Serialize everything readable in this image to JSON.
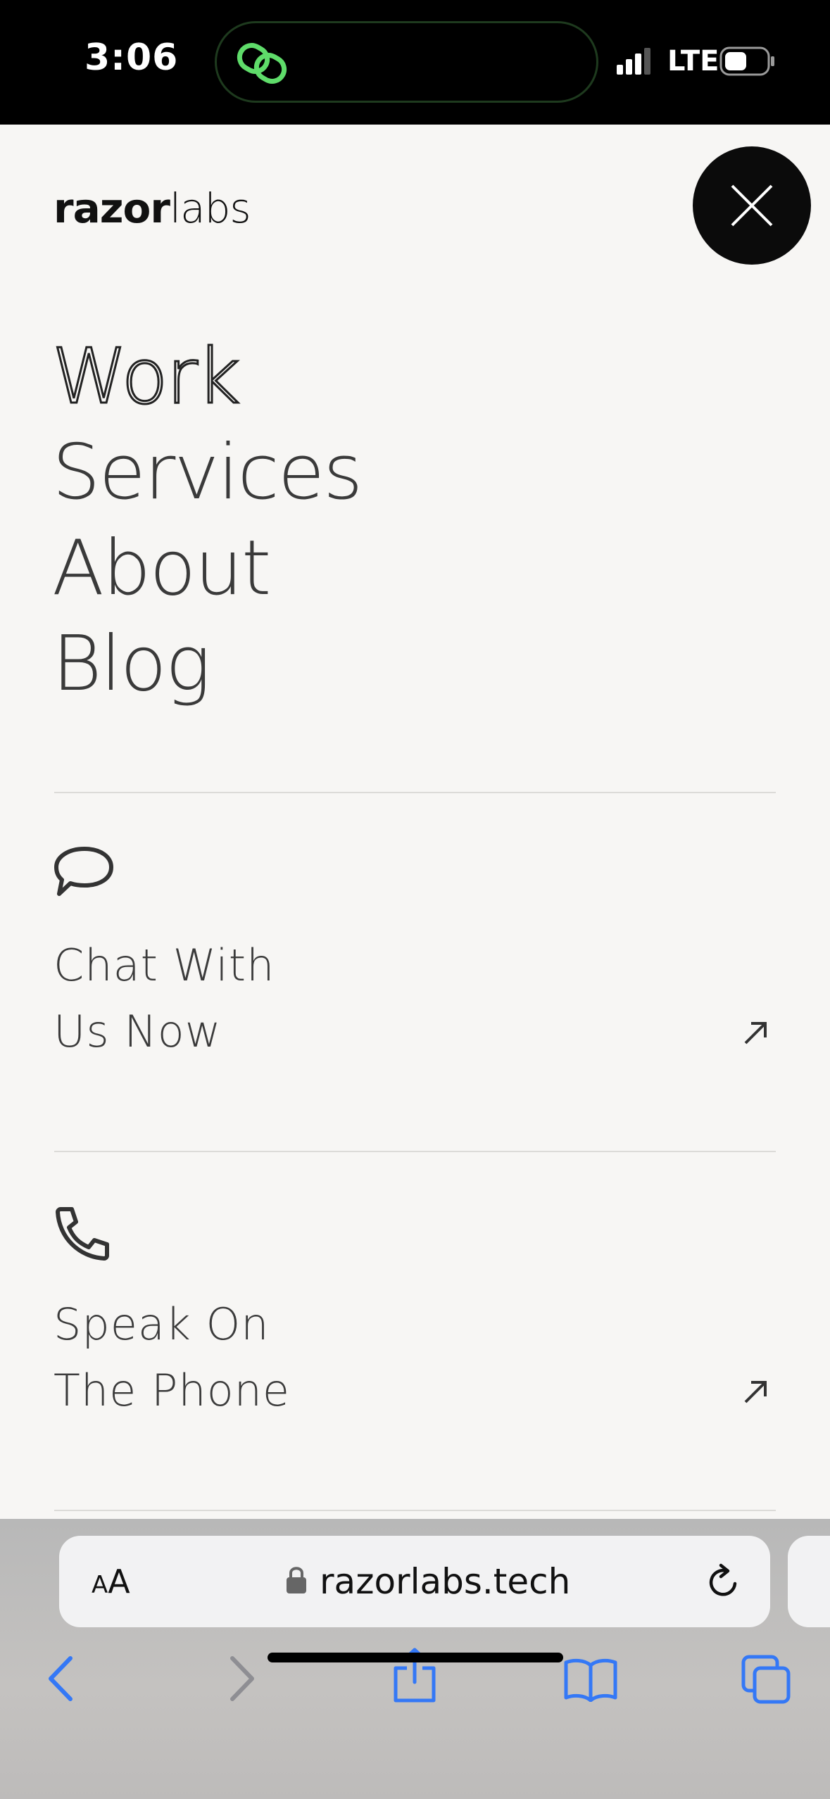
{
  "status_bar": {
    "time": "3:06",
    "network": "LTE"
  },
  "header": {
    "logo_part1": "razor",
    "logo_part2": "labs"
  },
  "nav": {
    "items": [
      "Work",
      "Services",
      "About",
      "Blog"
    ]
  },
  "contacts": [
    {
      "line1": "Chat With",
      "line2": "Us Now",
      "icon": "chat-bubble-icon"
    },
    {
      "line1": "Speak On",
      "line2": "The Phone",
      "icon": "phone-icon"
    }
  ],
  "browser": {
    "text_size_label": "AA",
    "domain": "razorlabs.tech"
  },
  "colors": {
    "background": "#f7f6f4",
    "close_button": "#0b0b0b",
    "safari_blue": "#3478f6",
    "island_link": "#4cd964"
  }
}
